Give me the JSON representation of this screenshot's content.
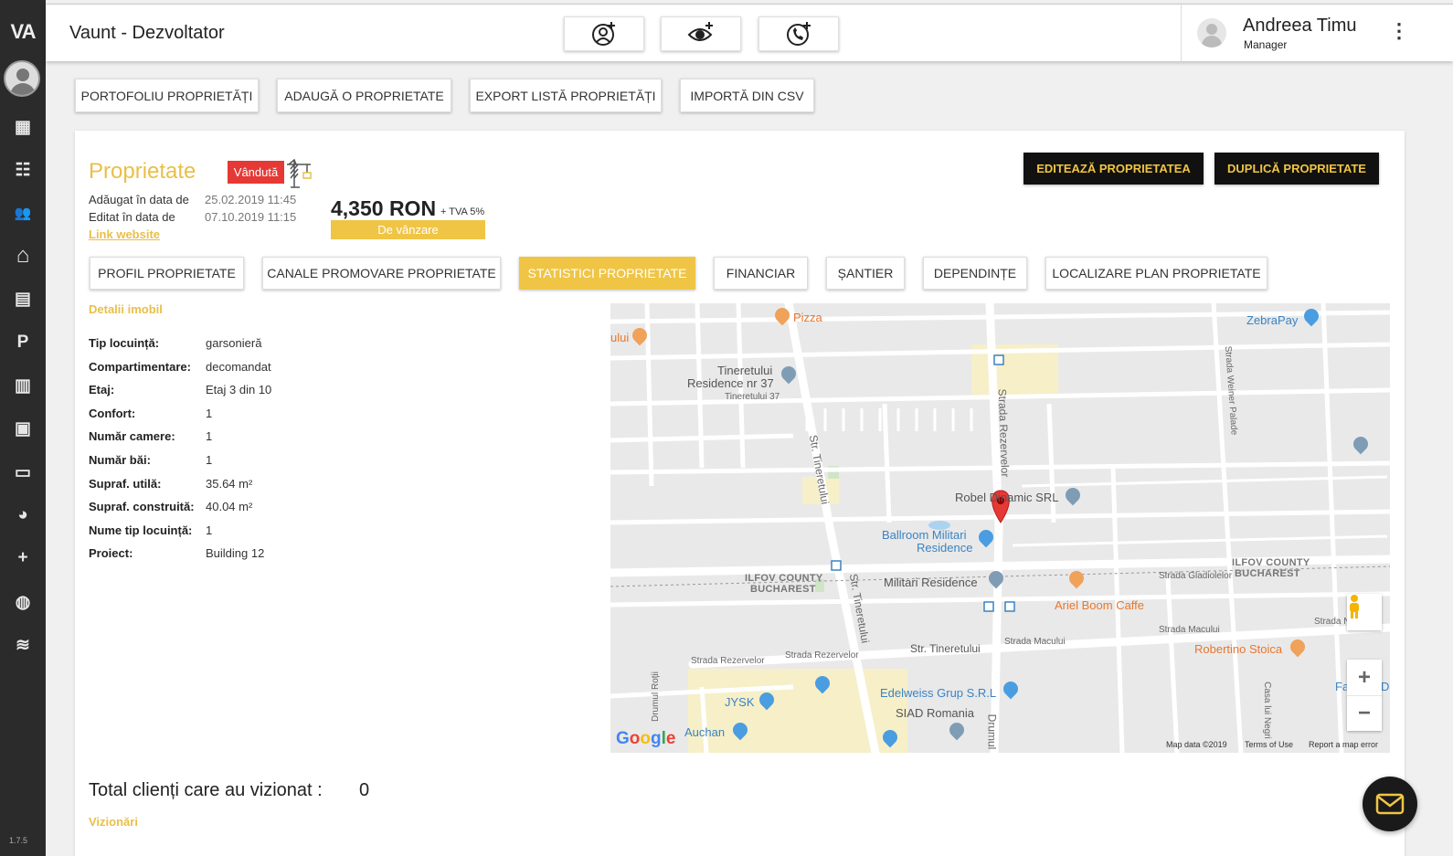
{
  "sidebar": {
    "logo": "VA",
    "version": "1.7.5",
    "items": [
      {
        "name": "dashboard-icon",
        "glyph": "▦"
      },
      {
        "name": "contacts-icon",
        "glyph": "☷"
      },
      {
        "name": "users-icon",
        "glyph": "👥"
      },
      {
        "name": "home-icon",
        "glyph": "⌂"
      },
      {
        "name": "trending-icon",
        "glyph": "▤"
      },
      {
        "name": "parking-icon",
        "glyph": "P"
      },
      {
        "name": "buildings-icon",
        "glyph": "▥"
      },
      {
        "name": "clipboard-icon",
        "glyph": "▣"
      },
      {
        "name": "card-icon",
        "glyph": "▭"
      },
      {
        "name": "pie-chart-icon",
        "glyph": "◕"
      },
      {
        "name": "add-group-icon",
        "glyph": "+"
      },
      {
        "name": "globe-icon",
        "glyph": "◍"
      },
      {
        "name": "rss-icon",
        "glyph": "≋"
      }
    ]
  },
  "header": {
    "title": "Vaunt - Dezvoltator",
    "user_name": "Andreea Timu",
    "user_role": "Manager"
  },
  "actions": {
    "portfolio": "PORTOFOLIU PROPRIETĂȚI",
    "add": "ADAUGĂ O PROPRIETATE",
    "export": "EXPORT LISTĂ PROPRIETĂȚI",
    "import": "IMPORTĂ DIN CSV"
  },
  "property": {
    "heading": "Proprietate",
    "status_badge": "Vândută",
    "added_label": "Adăugat în data de",
    "added_value": "25.02.2019 11:45",
    "edited_label": "Editat în data de",
    "edited_value": "07.10.2019 11:15",
    "link_label": "Link website",
    "price": "4,350 RON",
    "vat": "+ TVA 5%",
    "sale_type": "De vânzare",
    "edit_button": "EDITEAZĂ PROPRIETATEA",
    "duplicate_button": "DUPLICĂ PROPRIETATE"
  },
  "tabs": [
    "PROFIL PROPRIETATE",
    "CANALE PROMOVARE PROPRIETATE",
    "STATISTICI PROPRIETATE",
    "FINANCIAR",
    "ȘANTIER",
    "DEPENDINȚE",
    "LOCALIZARE PLAN PROPRIETATE"
  ],
  "details": {
    "section_title": "Detalii imobil",
    "rows": [
      {
        "label": "Tip locuință:",
        "value": "garsonieră"
      },
      {
        "label": "Compartimentare:",
        "value": "decomandat"
      },
      {
        "label": "Etaj:",
        "value": "Etaj 3 din 10"
      },
      {
        "label": "Confort:",
        "value": "1"
      },
      {
        "label": "Număr camere:",
        "value": "1"
      },
      {
        "label": "Număr băi:",
        "value": "1"
      },
      {
        "label": "Supraf. utilă:",
        "value": "35.64 m²"
      },
      {
        "label": "Supraf. construită:",
        "value": "40.04 m²"
      },
      {
        "label": "Nume tip locuință:",
        "value": "1"
      },
      {
        "label": "Proiect:",
        "value": "Building 12"
      }
    ]
  },
  "map": {
    "labels": {
      "pizza": "Pizza",
      "ului": "ului",
      "zebrapay": "ZebraPay",
      "tineretului_res": "Tineretului",
      "tineretului_res2": "Residence nr 37",
      "tineretului37": "Tineretului 37",
      "robel": "Robel Dinamic SRL",
      "ballroom": "Ballroom Militari",
      "ballroom2": "Residence",
      "militari": "Militari Residence",
      "ariel": "Ariel Boom Caffe",
      "robertino": "Robertino Stoica",
      "edelweiss": "Edelweiss Grup S.R.L",
      "siad": "SIAD Romania",
      "jysk": "JYSK",
      "auchan": "Auchan",
      "ilfov_left": "ILFOV COUNTY",
      "bucharest_left": "BUCHAREST",
      "ilfov_right": "ILFOV COUNTY",
      "bucharest_right": "BUCHAREST",
      "str_tineretului": "Str. Tineretului",
      "str_tineretului2": "Str. Tineretului",
      "str_tineretului3": "Str. Tineretului",
      "strada_rezervelor": "Strada Rezervelor",
      "strada_rezervelor2": "Strada Rezervelor",
      "strada_rezervelor3": "Strada Rezervelor",
      "strada_gladiolelor": "Strada Gladiolelor",
      "strada_macului": "Strada Macului",
      "strada_macului2": "Strada Macului",
      "strada_weiner": "Strada Weiner Palade",
      "drumul_rotii": "Drumul Roții",
      "drumul": "Drumul",
      "strada_n": "Strada N",
      "casa_negri": "Casa lui Negri",
      "fa": "Fa",
      "de": "De"
    },
    "google": "Google",
    "map_data": "Map data ©2019",
    "terms": "Terms of Use",
    "report": "Report a map error",
    "zoom_in": "+",
    "zoom_out": "−"
  },
  "visits": {
    "total_label": "Total clienți care au vizionat :",
    "total_value": "0",
    "section_title": "Vizionări"
  },
  "colors": {
    "accent": "#f0c545",
    "sold": "#e53935",
    "sidebar": "#2b2b2b"
  }
}
